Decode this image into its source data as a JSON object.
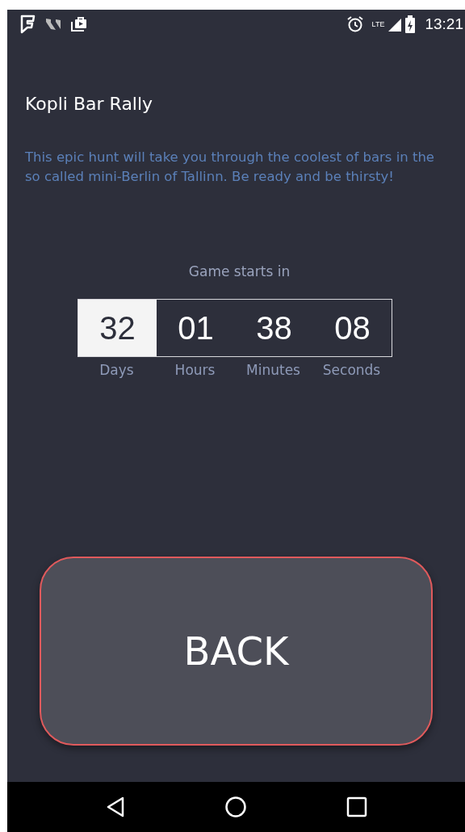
{
  "status_bar": {
    "time": "13:21",
    "network": "LTE"
  },
  "title": "Kopli Bar Rally",
  "description": "This epic hunt will take you through the coolest of bars in the so called mini-Berlin of Tallinn. Be ready and be thirsty!",
  "countdown": {
    "caption": "Game starts in",
    "units": [
      {
        "value": "32",
        "label": "Days",
        "selected": true
      },
      {
        "value": "01",
        "label": "Hours",
        "selected": false
      },
      {
        "value": "38",
        "label": "Minutes",
        "selected": false
      },
      {
        "value": "08",
        "label": "Seconds",
        "selected": false
      }
    ]
  },
  "back_button": {
    "label": "BACK"
  }
}
